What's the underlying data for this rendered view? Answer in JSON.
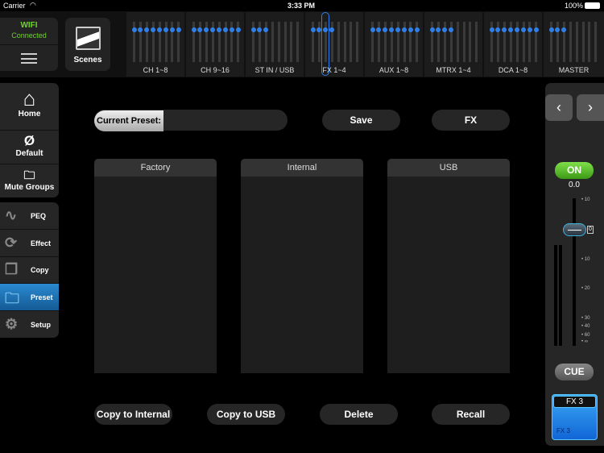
{
  "status": {
    "carrier": "Carrier",
    "time": "3:33 PM",
    "battery": "100%"
  },
  "wifi": {
    "title": "WIFI",
    "state": "Connected"
  },
  "scenes_label": "Scenes",
  "banks": [
    {
      "label": "CH 1~8",
      "dots": 8
    },
    {
      "label": "CH 9~16",
      "dots": 8
    },
    {
      "label": "ST IN / USB",
      "dots": 3
    },
    {
      "label": "FX 1~4",
      "dots": 4,
      "selected": true
    },
    {
      "label": "AUX 1~8",
      "dots": 8
    },
    {
      "label": "MTRX 1~4",
      "dots": 4
    },
    {
      "label": "DCA 1~8",
      "dots": 8
    },
    {
      "label": "MASTER",
      "dots": 3
    }
  ],
  "sidebar": {
    "top": [
      "Home",
      "Default",
      "Mute Groups"
    ],
    "tools": [
      "PEQ",
      "Effect",
      "Copy",
      "Preset",
      "Setup"
    ],
    "active": "Preset"
  },
  "main": {
    "current_preset_label": "Current Preset:",
    "current_preset_value": "",
    "save": "Save",
    "fx": "FX",
    "lists": [
      "Factory",
      "Internal",
      "USB"
    ],
    "actions": [
      "Copy to Internal",
      "Copy to USB",
      "Delete",
      "Recall"
    ]
  },
  "strip": {
    "on": "ON",
    "level": "0.0",
    "scale_top": "10",
    "zero": "0",
    "scale": [
      "10",
      "20",
      "30",
      "40",
      "60",
      "∞"
    ],
    "cue": "CUE",
    "name": "FX 3",
    "sub": "FX 3"
  },
  "colors": {
    "accent": "#2f7fe8",
    "on": "#4cbb1c",
    "preset": "#1a6fb5"
  }
}
